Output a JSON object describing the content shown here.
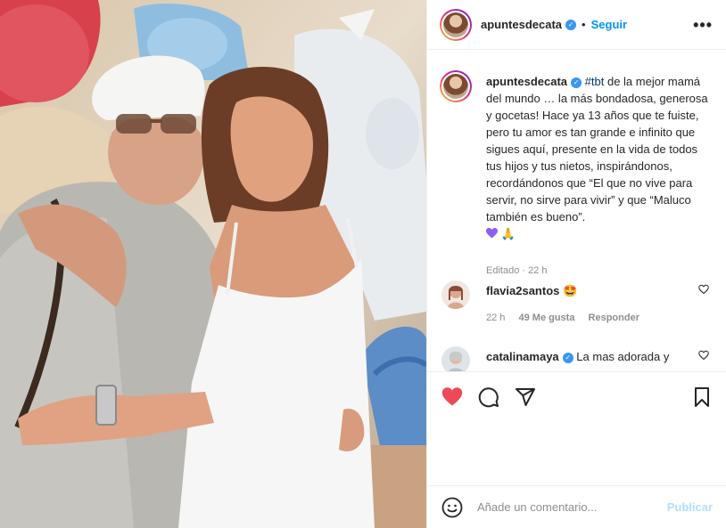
{
  "post": {
    "username": "apuntesdecata",
    "follow_label": "Seguir",
    "separator": "•",
    "more_label": "•••"
  },
  "caption": {
    "username": "apuntesdecata",
    "hashtag": "#tbt",
    "text": " de la mejor mamá del mundo … la más bondadosa, generosa y gocetas! Hace ya 13 años que te fuiste, pero tu amor es tan grande e infinito que sigues aquí, presente en la vida de todos tus hijos y tus nietos, inspirándonos, recordándonos que “El que no vive para servir, no sirve para vivir” y que “Maluco también es bueno”.",
    "emoji_end": "🙏",
    "edited_label": "Editado",
    "separator": "·",
    "time": "22 h"
  },
  "comments": [
    {
      "username": "flavia2santos",
      "text": "🤩",
      "time": "22 h",
      "likes": "49 Me gusta",
      "reply_label": "Responder"
    },
    {
      "username": "catalinamaya",
      "text": "La mas adorada y"
    }
  ],
  "composer": {
    "placeholder": "Añade un comentario...",
    "publish_label": "Publicar"
  },
  "icons": {
    "verified": "verified-badge-icon",
    "like": "heart-filled-icon",
    "comment": "comment-bubble-icon",
    "share": "paper-plane-icon",
    "save": "bookmark-icon",
    "emoji": "smiley-icon"
  },
  "colors": {
    "like_red": "#ed4956",
    "link_blue": "#0095f6",
    "publish_disabled": "#b2dffc",
    "verified_blue": "#3897f0",
    "meta_gray": "#8e8e8e"
  }
}
